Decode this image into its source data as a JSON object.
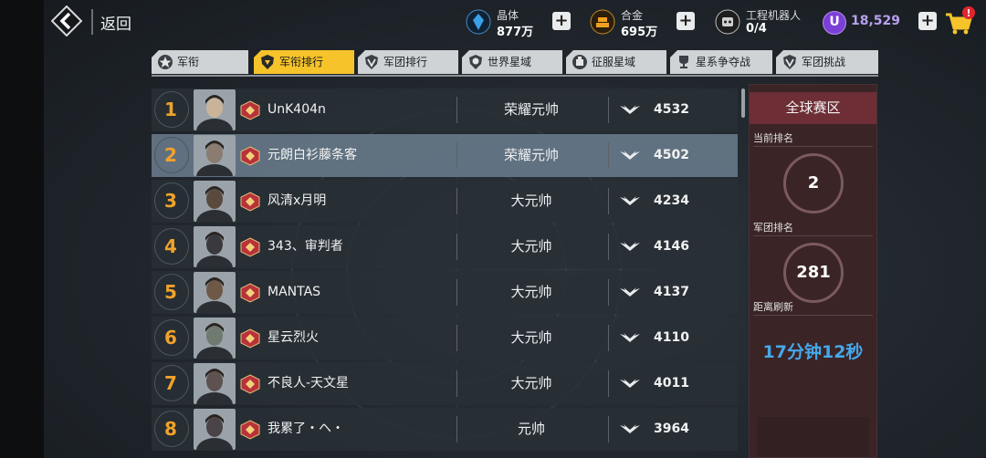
{
  "topbar": {
    "back_label": "返回"
  },
  "resources": [
    {
      "label": "晶体",
      "value": "877万",
      "icon": "crystal-icon",
      "color": "#3aa0e8"
    },
    {
      "label": "合金",
      "value": "695万",
      "icon": "alloy-icon",
      "color": "#f0a020"
    },
    {
      "label": "工程机器人",
      "value": "0/4",
      "icon": "robot-icon",
      "color": "#d0d0d0"
    }
  ],
  "premium": {
    "badge": "U",
    "value": "18,529"
  },
  "cart": {
    "alert": "!"
  },
  "tabs": [
    {
      "label": "军衔",
      "icon": "star-badge-icon"
    },
    {
      "label": "军衔排行",
      "icon": "rank-shield-icon",
      "active": true
    },
    {
      "label": "军团排行",
      "icon": "legion-icon"
    },
    {
      "label": "世界星域",
      "icon": "planet-icon"
    },
    {
      "label": "征服星域",
      "icon": "conquest-icon"
    },
    {
      "label": "星系争夺战",
      "icon": "trophy-icon"
    },
    {
      "label": "军团挑战",
      "icon": "legion-challenge-icon"
    }
  ],
  "leaderboard": {
    "selected_rank": 2,
    "rows": [
      {
        "rank": "1",
        "name": "UnK404n",
        "title": "荣耀元帅",
        "score": "4532"
      },
      {
        "rank": "2",
        "name": "元朗白衫藤条客",
        "title": "荣耀元帅",
        "score": "4502"
      },
      {
        "rank": "3",
        "name": "风清x月明",
        "title": "大元帅",
        "score": "4234"
      },
      {
        "rank": "4",
        "name": "343、审判者",
        "title": "大元帅",
        "score": "4146"
      },
      {
        "rank": "5",
        "name": "MANTAS",
        "title": "大元帅",
        "score": "4137"
      },
      {
        "rank": "6",
        "name": "星云烈火",
        "title": "大元帅",
        "score": "4110"
      },
      {
        "rank": "7",
        "name": "不良人-天文星",
        "title": "大元帅",
        "score": "4011"
      },
      {
        "rank": "8",
        "name": "我累了・ヘ・",
        "title": "元帅",
        "score": "3964"
      }
    ]
  },
  "side_panel": {
    "header": "全球赛区",
    "current_rank_label": "当前排名",
    "current_rank": "2",
    "legion_rank_label": "军团排名",
    "legion_rank": "281",
    "refresh_label": "距离刷新",
    "refresh_timer": "17分钟12秒"
  },
  "colors": {
    "accent": "#f6c42a",
    "rank_number": "#f0a22a",
    "timer": "#46a8ea",
    "panel_header": "#6e2e35"
  }
}
